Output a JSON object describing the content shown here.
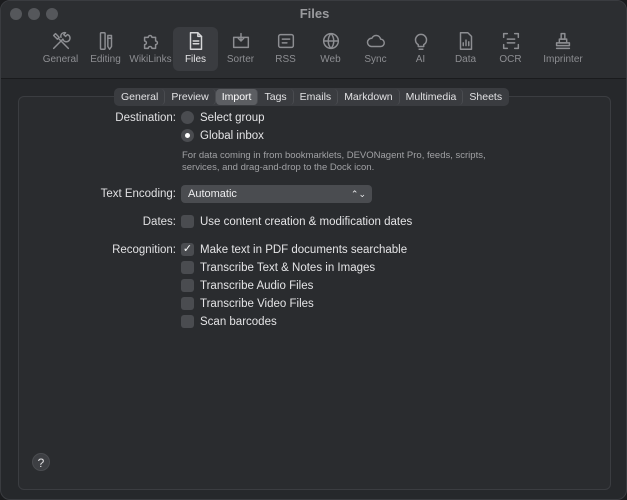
{
  "window": {
    "title": "Files"
  },
  "toolbar": {
    "items": [
      {
        "label": "General",
        "icon": "wrench-screwdriver-icon"
      },
      {
        "label": "Editing",
        "icon": "pencil-ruler-icon"
      },
      {
        "label": "WikiLinks",
        "icon": "puzzle-icon"
      },
      {
        "label": "Files",
        "icon": "document-icon",
        "active": true
      },
      {
        "label": "Sorter",
        "icon": "sorter-tray-icon"
      },
      {
        "label": "RSS",
        "icon": "rss-icon"
      },
      {
        "label": "Web",
        "icon": "globe-icon"
      },
      {
        "label": "Sync",
        "icon": "cloud-icon"
      },
      {
        "label": "AI",
        "icon": "lightbulb-icon"
      },
      {
        "label": "Data",
        "icon": "database-icon"
      },
      {
        "label": "OCR",
        "icon": "ocr-scan-icon"
      },
      {
        "label": "Imprinter",
        "icon": "stamp-icon"
      }
    ]
  },
  "tabs": [
    "General",
    "Preview",
    "Import",
    "Tags",
    "Emails",
    "Markdown",
    "Multimedia",
    "Sheets"
  ],
  "active_tab": "Import",
  "form": {
    "destination": {
      "label": "Destination:",
      "options": [
        "Select group",
        "Global inbox"
      ],
      "selected": "Global inbox",
      "help": "For data coming in from bookmarklets, DEVONagent Pro, feeds, scripts, services, and drag-and-drop to the Dock icon."
    },
    "encoding": {
      "label": "Text Encoding:",
      "value": "Automatic"
    },
    "dates": {
      "label": "Dates:",
      "option": "Use content creation & modification dates",
      "checked": false
    },
    "recognition": {
      "label": "Recognition:",
      "options": [
        {
          "label": "Make text in PDF documents searchable",
          "checked": true
        },
        {
          "label": "Transcribe Text & Notes in Images",
          "checked": false
        },
        {
          "label": "Transcribe Audio Files",
          "checked": false
        },
        {
          "label": "Transcribe Video Files",
          "checked": false
        },
        {
          "label": "Scan barcodes",
          "checked": false
        }
      ]
    }
  },
  "help_button": "?"
}
